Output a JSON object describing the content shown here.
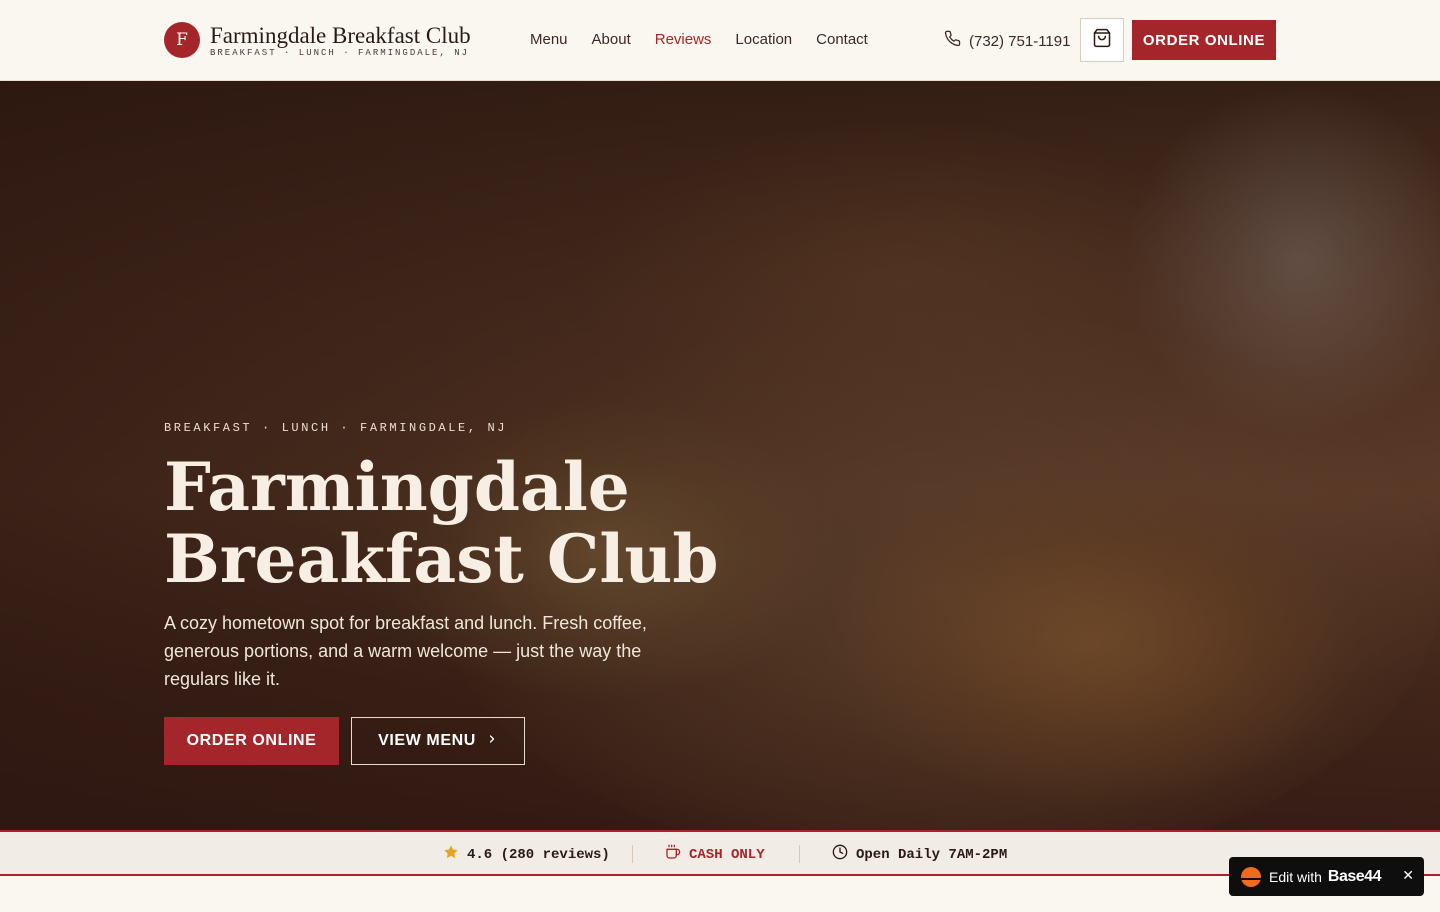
{
  "header": {
    "logo_letter": "F",
    "brand_name": "Farmingdale Breakfast Club",
    "brand_subtitle": "BREAKFAST · LUNCH · FARMINGDALE, NJ",
    "nav": [
      {
        "label": "Menu",
        "active": false
      },
      {
        "label": "About",
        "active": false
      },
      {
        "label": "Reviews",
        "active": true
      },
      {
        "label": "Location",
        "active": false
      },
      {
        "label": "Contact",
        "active": false
      }
    ],
    "phone": "(732) 751-1191",
    "order_label": "ORDER ONLINE"
  },
  "hero": {
    "eyebrow": "BREAKFAST · LUNCH · FARMINGDALE, NJ",
    "title_line1": "Farmingdale",
    "title_line2": "Breakfast Club",
    "description": "A cozy hometown spot for breakfast and lunch. Fresh coffee, generous portions, and a warm welcome — just the way the regulars like it.",
    "order_label": "ORDER ONLINE",
    "menu_label": "VIEW MENU"
  },
  "infobar": {
    "rating": "4.6 (280 reviews)",
    "payment": "CASH ONLY",
    "hours": "Open Daily 7AM-2PM"
  },
  "badge": {
    "text": "Edit with",
    "brand": "Base44",
    "close": "✕"
  },
  "colors": {
    "accent": "#a5262a",
    "background": "#faf6f0",
    "star": "#e6a323"
  }
}
